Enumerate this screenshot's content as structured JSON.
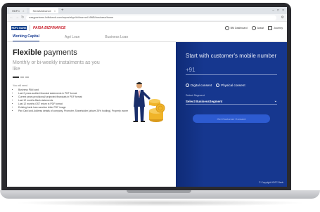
{
  "browser": {
    "tabs": [
      {
        "label": "HDFC"
      },
      {
        "label": "SmartAdvance"
      }
    ],
    "new_tab": "+",
    "window_controls": [
      "–",
      "□",
      "×"
    ],
    "url": "easypartners.hdfcbank.com/mpos/ekyc/#/channel-NWB/business/home"
  },
  "header": {
    "logo_bank": "HDFC BANK",
    "logo_partner": "PAISA BIZFINANCE",
    "links": [
      {
        "label": "BM Dashboard"
      },
      {
        "label": "Assist"
      },
      {
        "label": "Journey"
      }
    ]
  },
  "product_tabs": [
    {
      "label": "Working Capital",
      "active": true
    },
    {
      "label": "Agri Loan",
      "active": false
    },
    {
      "label": "Business Loan",
      "active": false
    }
  ],
  "hero": {
    "heading_bold": "Flexible",
    "heading_rest": " payments",
    "subheading": "Monthly or bi-weekly instalments as you like"
  },
  "requirements": {
    "title": "You will need",
    "items": [
      "Business PAN card",
      "Last 2 years audited financial statements in PDF format",
      "Current years provisional/ projected financials in PDF format",
      "Last 12 months Bank statements",
      "Last 12 months GST return in PDF format",
      "Existing bank loan sanction letter PDF image",
      "Pan Card and Address details of company, Promoter, Shareholder (above 25% holding), Property owner"
    ]
  },
  "form": {
    "title": "Start with customer's mobile number",
    "phone_prefix": "+91",
    "consent_digital": "Digital consent",
    "consent_physical": "Physical consent",
    "segment_label": "Select Segment",
    "segment_value": "Select BusinessSegment",
    "submit_label": "Get Customer Consent",
    "copyright": "© Copyright HDFC Bank"
  },
  "colors": {
    "brand_blue": "#16378f",
    "brand_red": "#c81e2b",
    "button_blue": "#2d5bd1"
  }
}
